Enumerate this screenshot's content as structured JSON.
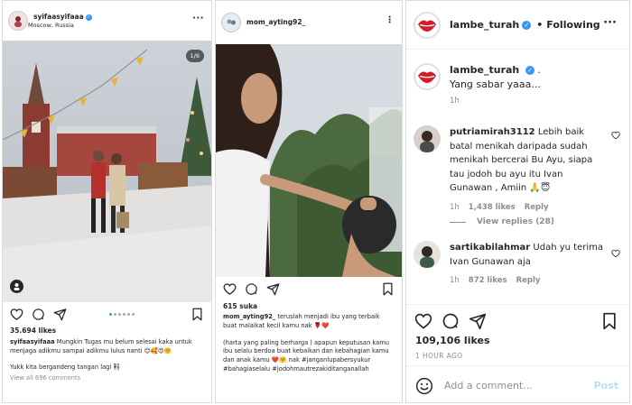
{
  "post1": {
    "username": "syifaasyifaaa",
    "location": "Moscow, Russia",
    "counter": "1/6",
    "likes": "35.694 likes",
    "caption_user": "syifaasyifaaa",
    "caption_text": "Mungkin Tugas mu belum selesai kaka untuk menjaga adikmu sampai adikmu lulus nanti 😊🥰😍🤗",
    "caption_line2": "Yukk kita bergandeng tangan lagi 👫",
    "view_all": "View all 696 comments"
  },
  "post2": {
    "username": "mom_ayting92_",
    "likes": "615 suka",
    "caption_user": "mom_ayting92_",
    "caption_text": "teruslah menjadi ibu yang terbaik buat malaikat kecil kamu nak 🌹❤️",
    "caption_more": "(harta yang paling berharga ) apapun keputusan kamu ibu selalu berdoa buat kebaikan dan kebahagian kamu dan anak kamu ❤️🤗 nak #janganlupabersyukur #bahagiaselalu #jodohmautrezakiditanganallah"
  },
  "detail": {
    "username": "lambe_turah",
    "follow_sep": "•",
    "follow_label": "Following",
    "caption_user": "lambe_turah",
    "caption_dot": ".",
    "caption_text": "Yang sabar yaaa...",
    "caption_time": "1h",
    "comments": [
      {
        "user": "putriamirah3112",
        "text": "Lebih baik batal menikah daripada sudah menikah bercerai Bu Ayu, siapa tau jodoh bu ayu itu Ivan Gunawan , Amiin 🙏😇",
        "time": "1h",
        "likes": "1,438 likes",
        "reply": "Reply"
      },
      {
        "user": "sartikabilahmar",
        "text": "Udah yu terima Ivan Gunawan aja",
        "time": "1h",
        "likes": "872 likes",
        "reply": "Reply"
      }
    ],
    "view_replies": "View replies (28)",
    "likes": "109,106 likes",
    "time_ago": "1 HOUR AGO",
    "add_comment_placeholder": "Add a comment...",
    "post_label": "Post"
  },
  "colors": {
    "verified": "#3897f0",
    "text": "#262626",
    "muted": "#8e8e8e",
    "post_disabled": "#b2dffc",
    "border": "#dbdbdb"
  },
  "icons": [
    "heart-icon",
    "comment-icon",
    "share-icon",
    "bookmark-icon",
    "more-icon",
    "smile-icon",
    "verified-icon",
    "tag-user-icon"
  ]
}
